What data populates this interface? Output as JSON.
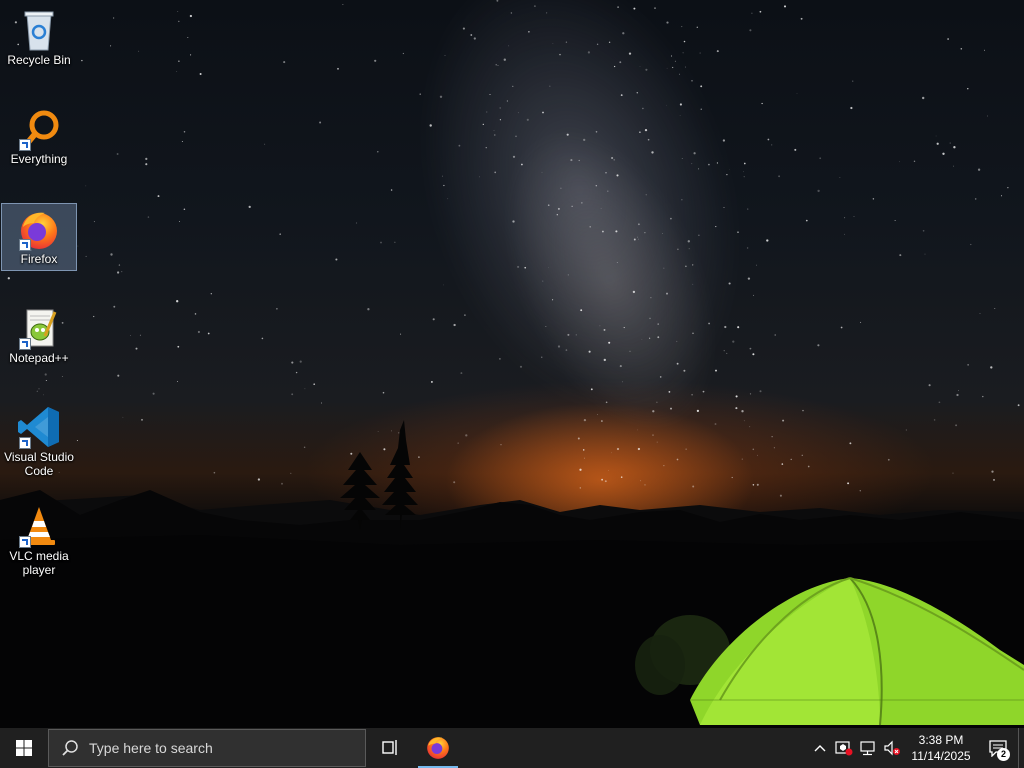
{
  "desktop": {
    "icons": [
      {
        "label": "Recycle Bin",
        "icon": "recycle-bin-icon"
      },
      {
        "label": "Everything",
        "icon": "everything-search-icon"
      },
      {
        "label": "Firefox",
        "icon": "firefox-icon",
        "selected": true
      },
      {
        "label": "Notepad++",
        "icon": "notepadpp-icon"
      },
      {
        "label": "Visual Studio Code",
        "icon": "vscode-icon"
      },
      {
        "label": "VLC media player",
        "icon": "vlc-icon"
      }
    ]
  },
  "taskbar": {
    "search_placeholder": "Type here to search",
    "pinned": [
      {
        "icon": "task-view-icon"
      },
      {
        "icon": "firefox-icon",
        "active": true
      }
    ],
    "tray": {
      "time": "3:38 PM",
      "date": "11/14/2025",
      "notification_count": "2",
      "icons": [
        "chevron-up-icon",
        "security-warning-icon",
        "network-icon",
        "volume-muted-icon"
      ]
    }
  },
  "colors": {
    "taskbar_bg": "#202020",
    "active_indicator": "#76b9ed",
    "tent": "#8fd62a"
  }
}
